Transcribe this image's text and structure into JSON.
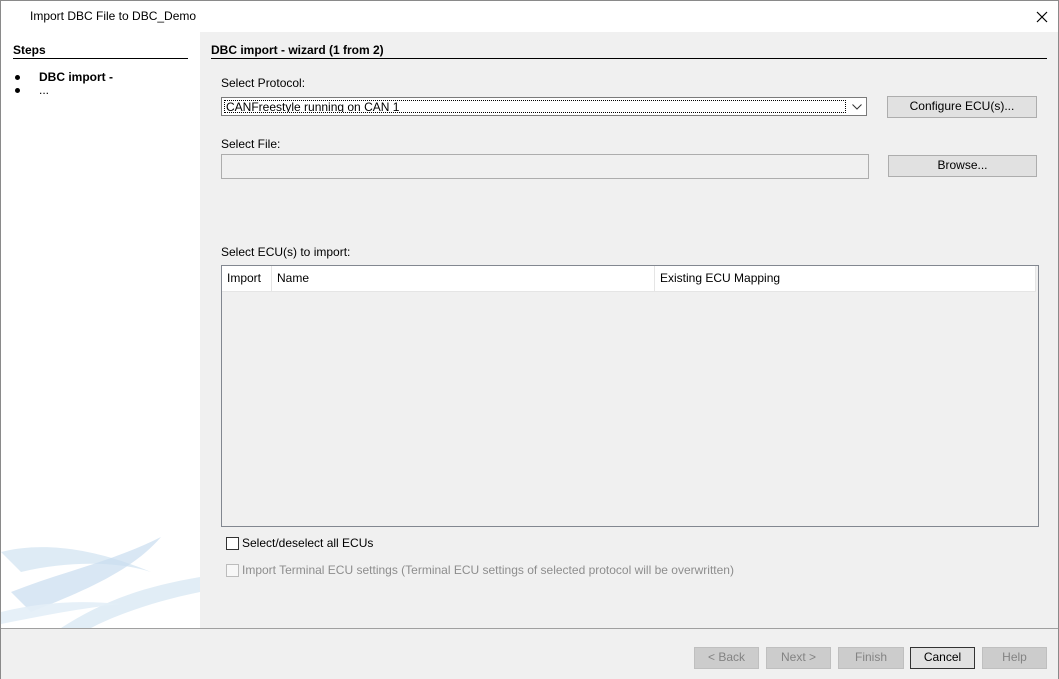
{
  "window": {
    "title": "Import DBC File to DBC_Demo"
  },
  "sidebar": {
    "heading": "Steps",
    "items": [
      {
        "label": "DBC import -"
      },
      {
        "label": "..."
      }
    ]
  },
  "main": {
    "heading": "DBC import -  wizard (1 from 2)",
    "protocol_label": "Select Protocol:",
    "protocol_value": "CANFreestyle running on CAN 1",
    "configure_button": "Configure ECU(s)...",
    "file_label": "Select File:",
    "file_value": "",
    "browse_button": "Browse...",
    "ecu_label": "Select ECU(s) to import:",
    "table": {
      "columns": [
        "Import",
        "Name",
        "Existing ECU Mapping"
      ],
      "rows": []
    },
    "select_all_label": "Select/deselect all ECUs",
    "select_all_checked": false,
    "import_terminal_label": "Import Terminal ECU settings (Terminal ECU settings of selected protocol will be overwritten)",
    "import_terminal_checked": false
  },
  "footer": {
    "back": "< Back",
    "next": "Next >",
    "finish": "Finish",
    "cancel": "Cancel",
    "help": "Help"
  },
  "icons": {
    "close": "close-icon",
    "dropdown": "chevron-down-icon",
    "watermark": "swoosh-graphic"
  },
  "colors": {
    "panel_bg": "#f0f0f0",
    "button_bg": "#e1e1e1",
    "disabled_button_bg": "#cccccc",
    "swoosh": "#cfe0f0"
  }
}
